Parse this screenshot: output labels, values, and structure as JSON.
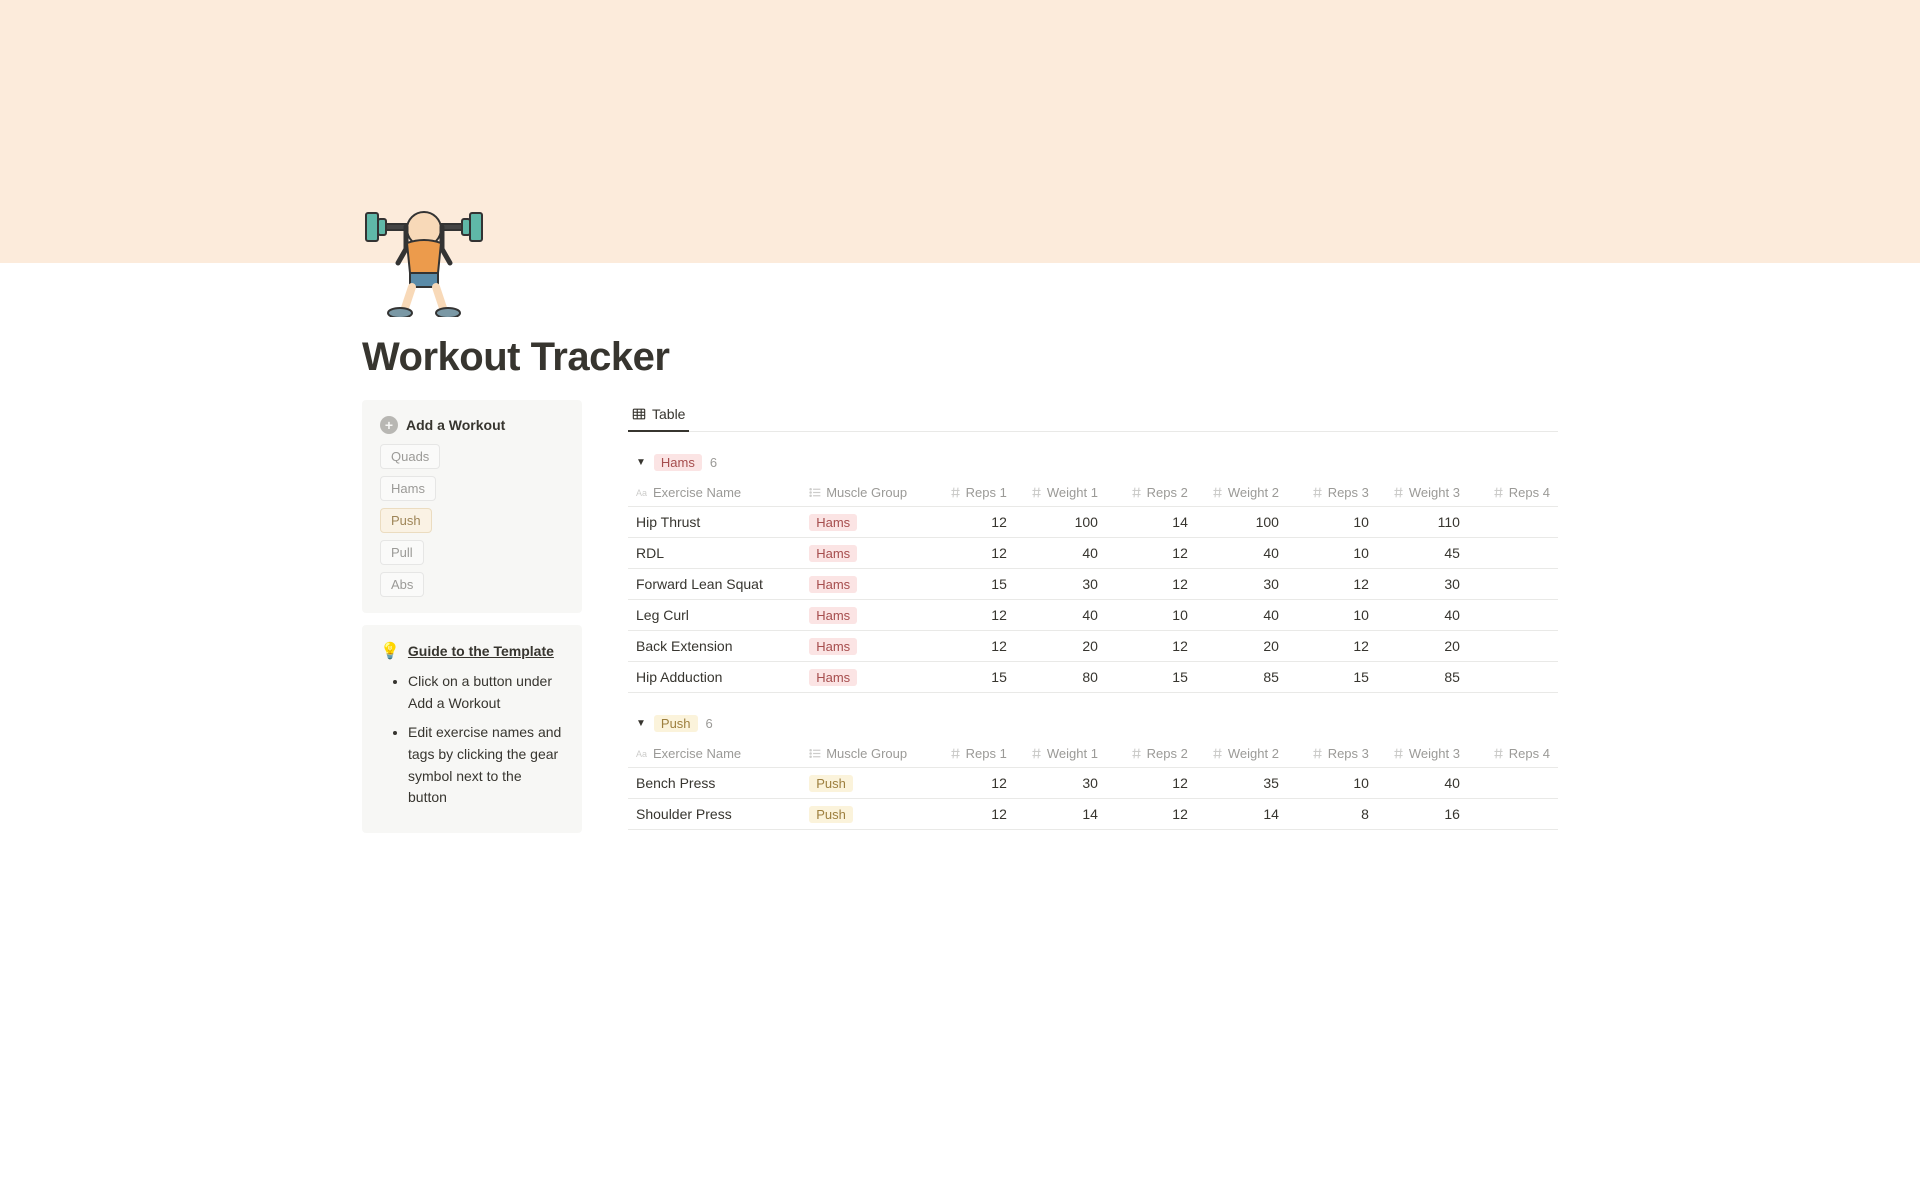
{
  "page": {
    "title": "Workout Tracker"
  },
  "sidebar": {
    "addWorkout": {
      "title": "Add a Workout",
      "buttons": [
        {
          "label": "Quads",
          "style": "default"
        },
        {
          "label": "Hams",
          "style": "default"
        },
        {
          "label": "Push",
          "style": "push"
        },
        {
          "label": "Pull",
          "style": "default"
        },
        {
          "label": "Abs",
          "style": "default"
        }
      ]
    },
    "guide": {
      "title": "Guide to the Template",
      "items": [
        "Click on a button under Add a Workout",
        "Edit exercise names and tags by clicking the gear symbol next to the button"
      ]
    }
  },
  "view": {
    "tabLabel": "Table"
  },
  "columns": [
    "Exercise Name",
    "Muscle Group",
    "Reps 1",
    "Weight 1",
    "Reps 2",
    "Weight 2",
    "Reps 3",
    "Weight 3",
    "Reps 4"
  ],
  "groups": [
    {
      "name": "Hams",
      "tagClass": "tag-hams",
      "count": 6,
      "rows": [
        {
          "name": "Hip Thrust",
          "mg": "Hams",
          "vals": [
            "12",
            "100",
            "14",
            "100",
            "10",
            "110",
            ""
          ]
        },
        {
          "name": "RDL",
          "mg": "Hams",
          "vals": [
            "12",
            "40",
            "12",
            "40",
            "10",
            "45",
            ""
          ]
        },
        {
          "name": "Forward Lean Squat",
          "mg": "Hams",
          "vals": [
            "15",
            "30",
            "12",
            "30",
            "12",
            "30",
            ""
          ]
        },
        {
          "name": "Leg Curl",
          "mg": "Hams",
          "vals": [
            "12",
            "40",
            "10",
            "40",
            "10",
            "40",
            ""
          ]
        },
        {
          "name": "Back Extension",
          "mg": "Hams",
          "vals": [
            "12",
            "20",
            "12",
            "20",
            "12",
            "20",
            ""
          ]
        },
        {
          "name": "Hip Adduction",
          "mg": "Hams",
          "vals": [
            "15",
            "80",
            "15",
            "85",
            "15",
            "85",
            ""
          ]
        }
      ]
    },
    {
      "name": "Push",
      "tagClass": "tag-push",
      "count": 6,
      "rows": [
        {
          "name": "Bench Press",
          "mg": "Push",
          "vals": [
            "12",
            "30",
            "12",
            "35",
            "10",
            "40",
            ""
          ]
        },
        {
          "name": "Shoulder Press",
          "mg": "Push",
          "vals": [
            "12",
            "14",
            "12",
            "14",
            "8",
            "16",
            ""
          ]
        }
      ]
    }
  ]
}
